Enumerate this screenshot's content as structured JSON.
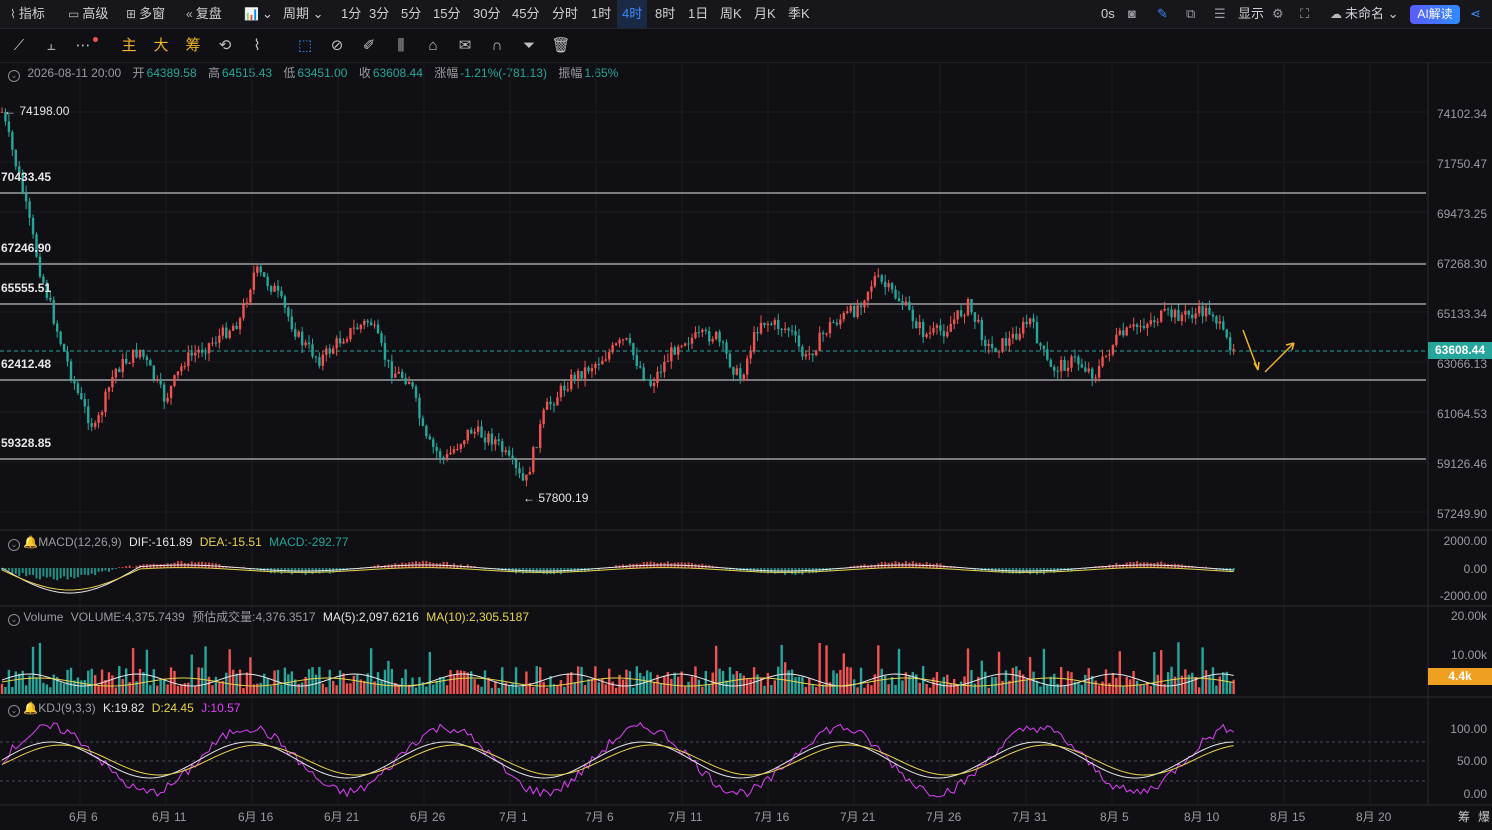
{
  "topbar": {
    "items": [
      {
        "icon": "indicator-icon",
        "label": "指标"
      },
      {
        "icon": "advanced-icon",
        "label": "高级"
      },
      {
        "icon": "multi-window-icon",
        "label": "多窗"
      },
      {
        "icon": "replay-icon",
        "label": "复盘"
      },
      {
        "icon": "chart-type-icon",
        "label": ""
      },
      {
        "icon": "",
        "label": "周期"
      }
    ],
    "periods": [
      "1分",
      "3分",
      "5分",
      "15分",
      "30分",
      "45分",
      "分时",
      "1时",
      "4时",
      "8时",
      "1日",
      "周K",
      "月K",
      "季K"
    ],
    "active_period": "4时",
    "right": {
      "seconds": "0s",
      "display": "显示",
      "layout_name": "未命名",
      "ai_button": "AI解读"
    }
  },
  "tools": {
    "text_tools": [
      "主",
      "大",
      "筹"
    ]
  },
  "ohlc": {
    "datetime": "2026-08-11 20:00",
    "open_label": "开",
    "open": "64389.58",
    "high_label": "高",
    "high": "64515.43",
    "low_label": "低",
    "low": "63451.00",
    "close_label": "收",
    "close": "63608.44",
    "change_label": "涨幅",
    "change": "-1.21%(-781.13)",
    "amp_label": "振幅",
    "amp": "1.65%"
  },
  "price_axis": [
    "74102.34",
    "71750.47",
    "69473.25",
    "67268.30",
    "65133.34",
    "63066.13",
    "61064.53",
    "59126.46",
    "57249.90"
  ],
  "levels": [
    "70433.45",
    "67246.90",
    "65555.51",
    "62412.48",
    "59328.85"
  ],
  "extremes": {
    "high": "74198.00",
    "low": "57800.19"
  },
  "current_price": "63608.44",
  "macd": {
    "title": "MACD(12,26,9)",
    "dif": "DIF:-161.89",
    "dea": "DEA:-15.51",
    "macd": "MACD:-292.77",
    "axis": [
      "2000.00",
      "0.00",
      "-2000.00"
    ]
  },
  "volume": {
    "title": "Volume",
    "vol": "VOLUME:4,375.7439",
    "est": "预估成交量:4,376.3517",
    "ma5": "MA(5):2,097.6216",
    "ma10": "MA(10):2,305.5187",
    "axis": [
      "20.00k",
      "10.00k"
    ],
    "tag": "4.4k"
  },
  "kdj": {
    "title": "KDJ(9,3,3)",
    "k": "K:19.82",
    "d": "D:24.45",
    "j": "J:10.57",
    "axis": [
      "100.00",
      "50.00",
      "0.00"
    ]
  },
  "x_labels": [
    "6月 6",
    "6月 11",
    "6月 16",
    "6月 21",
    "6月 26",
    "7月 1",
    "7月 6",
    "7月 11",
    "7月 16",
    "7月 21",
    "7月 26",
    "7月 31",
    "8月 5",
    "8月 10",
    "8月 15",
    "8月 20"
  ],
  "corner": [
    "筹",
    "爆"
  ],
  "colors": {
    "up": "#ef5350",
    "down": "#26a69a",
    "macd_dea": "#e8d44d",
    "kdj_d": "#e8d44d",
    "kdj_j": "#e040fb",
    "accent": "#3a8bff"
  }
}
